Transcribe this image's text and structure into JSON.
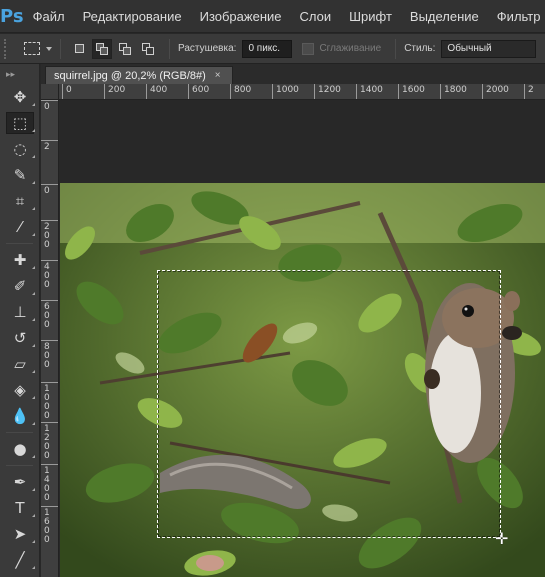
{
  "app": {
    "logo": "Ps"
  },
  "menu": [
    "Файл",
    "Редактирование",
    "Изображение",
    "Слои",
    "Шрифт",
    "Выделение",
    "Фильтр",
    "З"
  ],
  "options": {
    "feather_label": "Растушевка:",
    "feather_value": "0 пикс.",
    "antialias_label": "Сглаживание",
    "style_label": "Стиль:",
    "style_value": "Обычный"
  },
  "document": {
    "tab_title": "squirrel.jpg @ 20,2% (RGB/8#)",
    "close_glyph": "×"
  },
  "rulers": {
    "horizontal": [
      "0",
      "200",
      "400",
      "600",
      "800",
      "1000",
      "1200",
      "1400",
      "1600",
      "1800",
      "2000",
      "2"
    ],
    "vertical": [
      "0",
      "2",
      "0",
      "2\n0\n0",
      "4\n0\n0",
      "6\n0\n0",
      "8\n0\n0",
      "1\n0\n0\n0",
      "1\n2\n0\n0",
      "1\n4\n0\n0",
      "1\n6\n0\n0"
    ]
  },
  "tools": [
    {
      "name": "move-tool-icon",
      "glyph": "✥"
    },
    {
      "name": "rect-marquee-tool-icon",
      "glyph": "⬚",
      "active": true
    },
    {
      "name": "lasso-tool-icon",
      "glyph": "◌"
    },
    {
      "name": "quick-select-tool-icon",
      "glyph": "✎"
    },
    {
      "name": "crop-tool-icon",
      "glyph": "⌗"
    },
    {
      "name": "eyedropper-tool-icon",
      "glyph": "⁄"
    },
    {
      "name": "healing-brush-tool-icon",
      "glyph": "✚"
    },
    {
      "name": "brush-tool-icon",
      "glyph": "✐"
    },
    {
      "name": "clone-stamp-tool-icon",
      "glyph": "⊥"
    },
    {
      "name": "history-brush-tool-icon",
      "glyph": "↺"
    },
    {
      "name": "eraser-tool-icon",
      "glyph": "▱"
    },
    {
      "name": "paint-bucket-tool-icon",
      "glyph": "◈"
    },
    {
      "name": "blur-tool-icon",
      "glyph": "💧"
    },
    {
      "name": "dodge-tool-icon",
      "glyph": "●"
    },
    {
      "name": "pen-tool-icon",
      "glyph": "✒"
    },
    {
      "name": "type-tool-icon",
      "glyph": "T"
    },
    {
      "name": "path-select-tool-icon",
      "glyph": "➤"
    },
    {
      "name": "line-tool-icon",
      "glyph": "╱"
    }
  ],
  "colors": {
    "accent_logo": "#4aa3df",
    "foliage_dark": "#3c5620",
    "foliage_light": "#8fb54a",
    "squirrel_fur": "#8a7a6a"
  }
}
